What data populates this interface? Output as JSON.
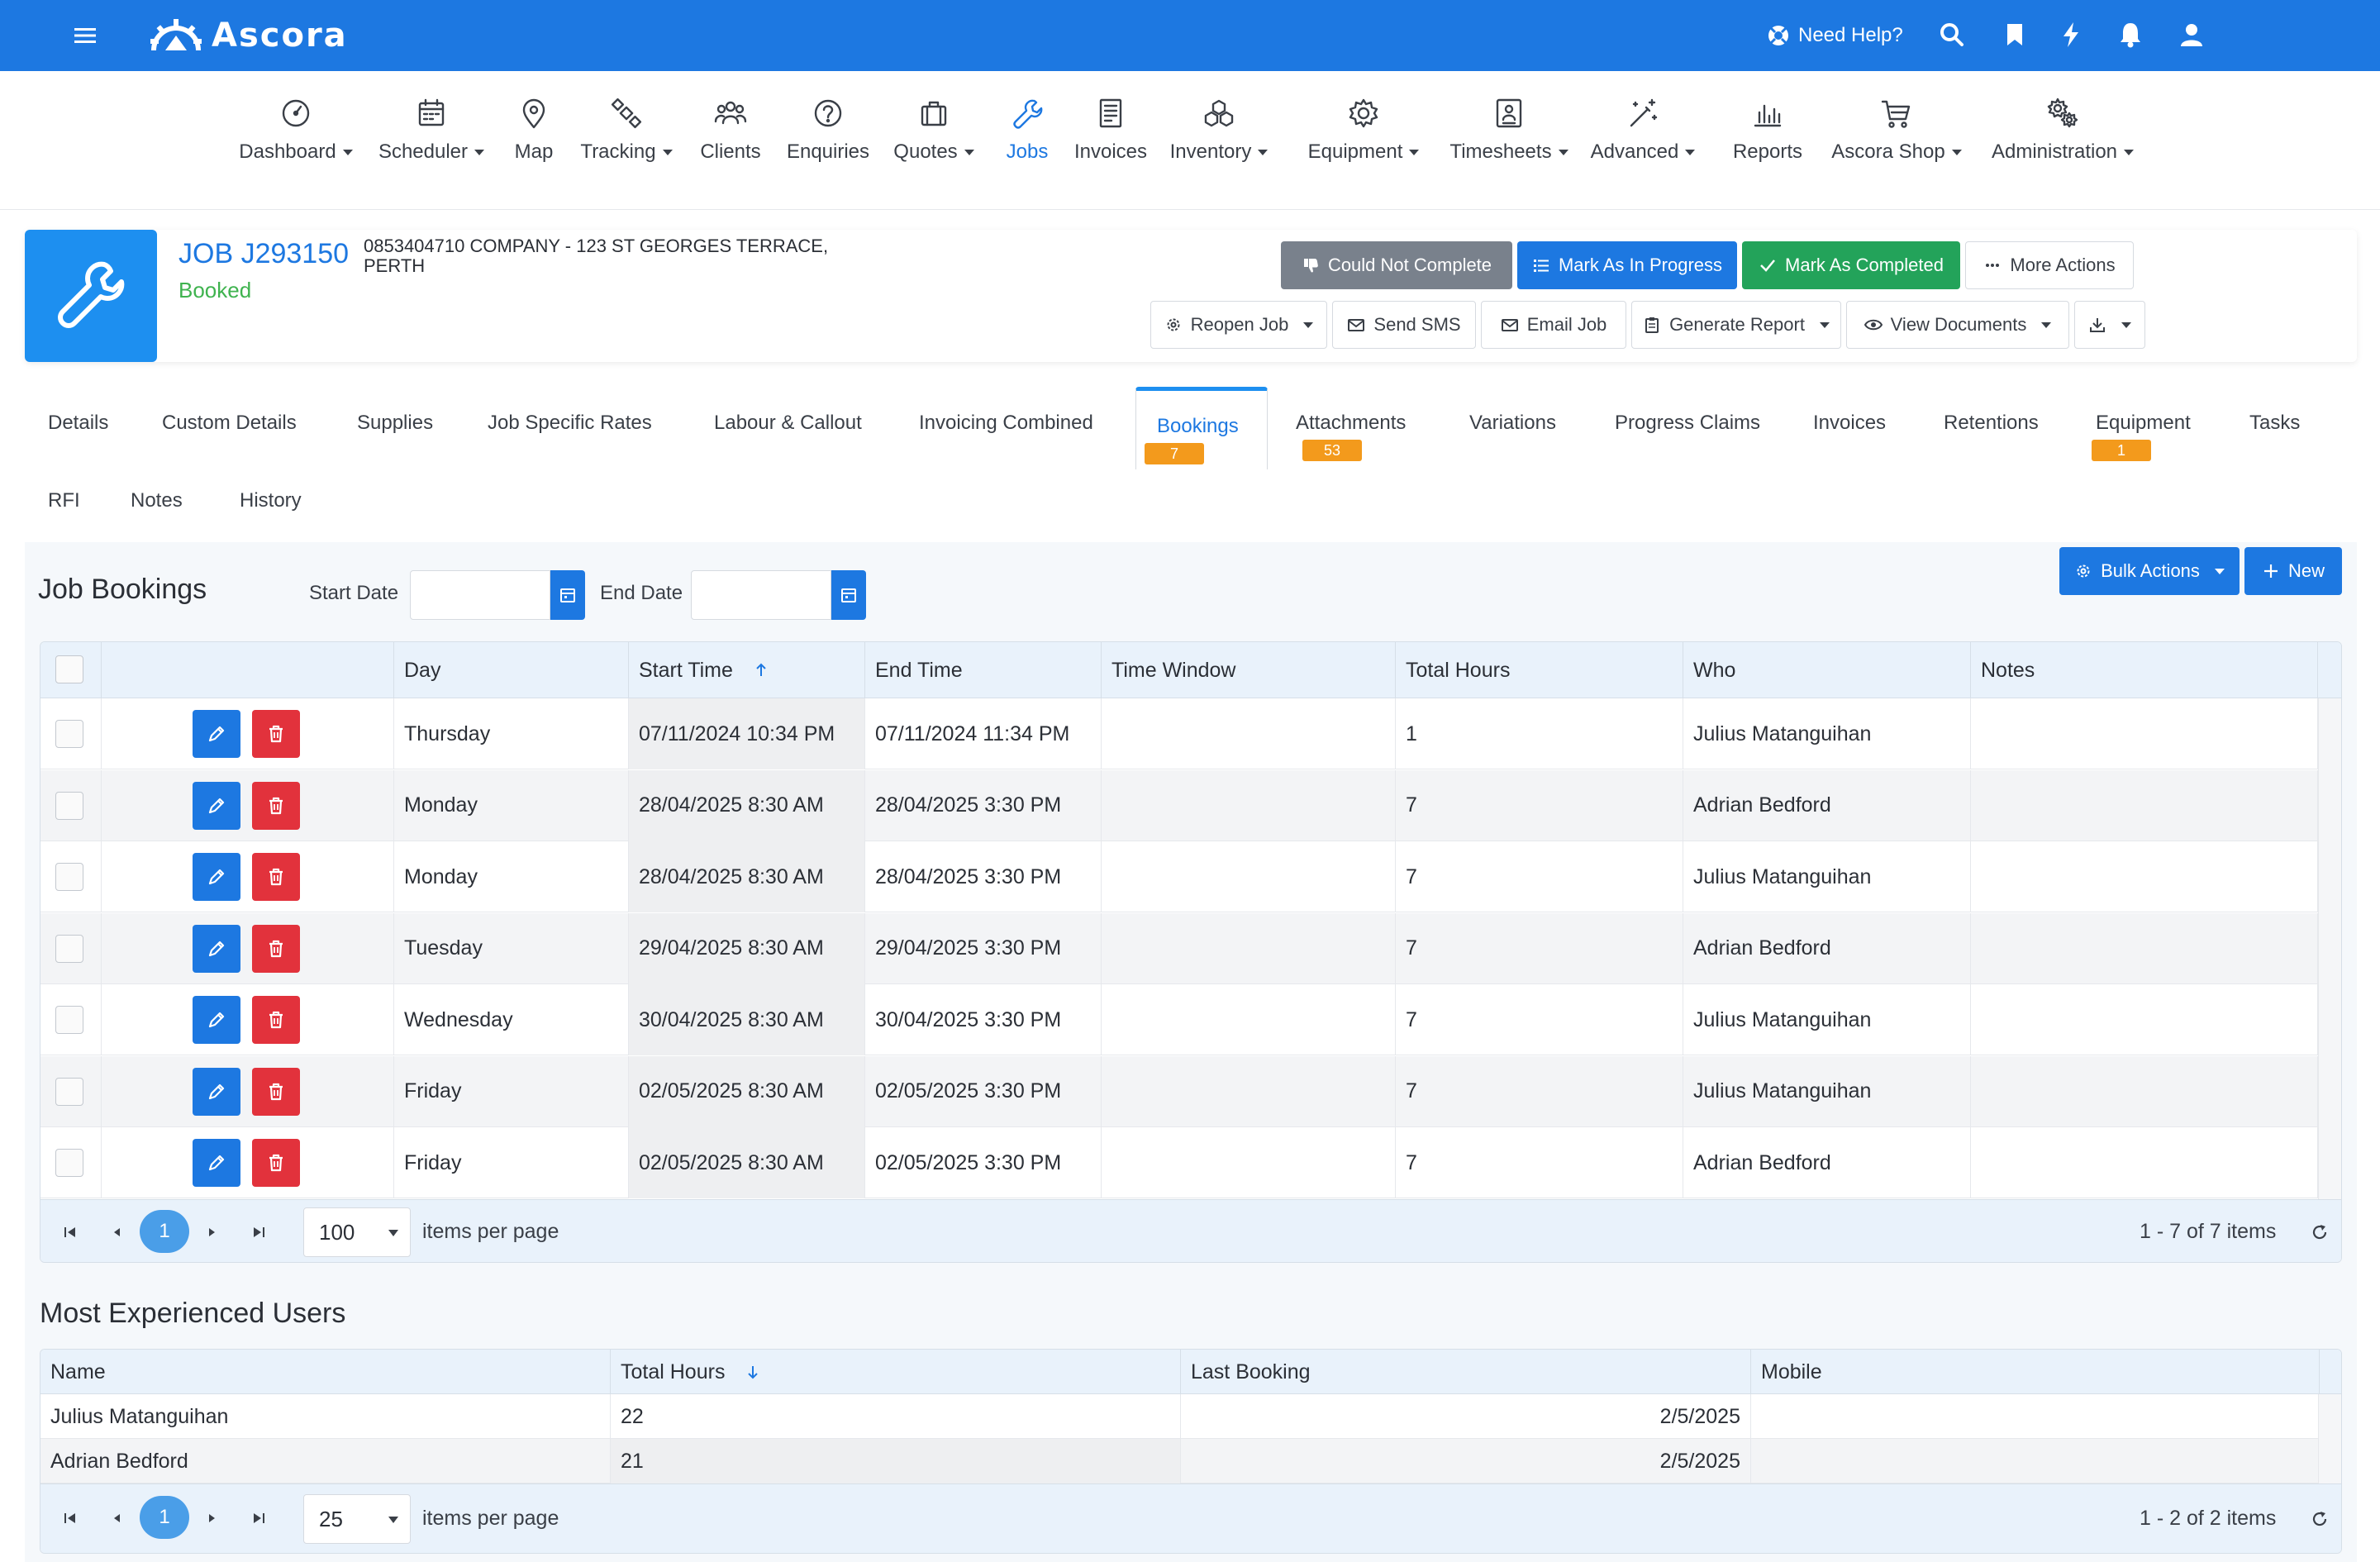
{
  "app": {
    "logo_text": "Ascora",
    "brand_color": "#1d78e1"
  },
  "topbar": {
    "help_label": "Need Help?"
  },
  "nav": [
    {
      "label": "Dashboard",
      "icon": "dashboard-icon",
      "dropdown": true
    },
    {
      "label": "Scheduler",
      "icon": "calendar-icon",
      "dropdown": true
    },
    {
      "label": "Map",
      "icon": "map-pin-icon",
      "dropdown": false
    },
    {
      "label": "Tracking",
      "icon": "satellite-icon",
      "dropdown": true
    },
    {
      "label": "Clients",
      "icon": "users-icon",
      "dropdown": false
    },
    {
      "label": "Enquiries",
      "icon": "question-icon",
      "dropdown": false
    },
    {
      "label": "Quotes",
      "icon": "briefcase-icon",
      "dropdown": true
    },
    {
      "label": "Jobs",
      "icon": "wrench-icon",
      "dropdown": false,
      "active": true
    },
    {
      "label": "Invoices",
      "icon": "invoice-icon",
      "dropdown": false
    },
    {
      "label": "Inventory",
      "icon": "boxes-icon",
      "dropdown": true
    },
    {
      "label": "Equipment",
      "icon": "gear-icon",
      "dropdown": true
    },
    {
      "label": "Timesheets",
      "icon": "timesheet-icon",
      "dropdown": true
    },
    {
      "label": "Advanced",
      "icon": "magic-wand-icon",
      "dropdown": true
    },
    {
      "label": "Reports",
      "icon": "bar-chart-icon",
      "dropdown": false
    },
    {
      "label": "Ascora Shop",
      "icon": "cart-icon",
      "dropdown": true
    },
    {
      "label": "Administration",
      "icon": "gears-icon",
      "dropdown": true
    }
  ],
  "job": {
    "title": "JOB J293150",
    "status": "Booked",
    "address": "0853404710 COMPANY - 123 ST GEORGES TERRACE, PERTH"
  },
  "actions": {
    "could_not_complete": "Could Not Complete",
    "mark_in_progress": "Mark As In Progress",
    "mark_completed": "Mark As Completed",
    "more_actions": "More Actions",
    "reopen_job": "Reopen Job",
    "send_sms": "Send SMS",
    "email_job": "Email Job",
    "generate_report": "Generate Report",
    "view_documents": "View Documents"
  },
  "tabs": [
    {
      "label": "Details"
    },
    {
      "label": "Custom Details"
    },
    {
      "label": "Supplies"
    },
    {
      "label": "Job Specific Rates"
    },
    {
      "label": "Labour & Callout"
    },
    {
      "label": "Invoicing Combined"
    },
    {
      "label": "Bookings",
      "badge": "7",
      "active": true
    },
    {
      "label": "Attachments",
      "badge": "53"
    },
    {
      "label": "Variations"
    },
    {
      "label": "Progress Claims"
    },
    {
      "label": "Invoices"
    },
    {
      "label": "Retentions"
    },
    {
      "label": "Equipment",
      "badge": "1"
    },
    {
      "label": "Tasks"
    },
    {
      "label": "RFI"
    },
    {
      "label": "Notes"
    },
    {
      "label": "History"
    }
  ],
  "bookings": {
    "title": "Job Bookings",
    "start_date_label": "Start Date",
    "end_date_label": "End Date",
    "start_date_value": "",
    "end_date_value": "",
    "bulk_actions_label": "Bulk Actions",
    "new_label": "New",
    "columns": [
      "Day",
      "Start Time",
      "End Time",
      "Time Window",
      "Total Hours",
      "Who",
      "Notes"
    ],
    "rows": [
      {
        "day": "Thursday",
        "start": "07/11/2024 10:34 PM",
        "end": "07/11/2024 11:34 PM",
        "window": "",
        "hours": "1",
        "who": "Julius Matanguihan",
        "notes": ""
      },
      {
        "day": "Monday",
        "start": "28/04/2025 8:30 AM",
        "end": "28/04/2025 3:30 PM",
        "window": "",
        "hours": "7",
        "who": "Adrian Bedford",
        "notes": ""
      },
      {
        "day": "Monday",
        "start": "28/04/2025 8:30 AM",
        "end": "28/04/2025 3:30 PM",
        "window": "",
        "hours": "7",
        "who": "Julius Matanguihan",
        "notes": ""
      },
      {
        "day": "Tuesday",
        "start": "29/04/2025 8:30 AM",
        "end": "29/04/2025 3:30 PM",
        "window": "",
        "hours": "7",
        "who": "Adrian Bedford",
        "notes": ""
      },
      {
        "day": "Wednesday",
        "start": "30/04/2025 8:30 AM",
        "end": "30/04/2025 3:30 PM",
        "window": "",
        "hours": "7",
        "who": "Julius Matanguihan",
        "notes": ""
      },
      {
        "day": "Friday",
        "start": "02/05/2025 8:30 AM",
        "end": "02/05/2025 3:30 PM",
        "window": "",
        "hours": "7",
        "who": "Julius Matanguihan",
        "notes": ""
      },
      {
        "day": "Friday",
        "start": "02/05/2025 8:30 AM",
        "end": "02/05/2025 3:30 PM",
        "window": "",
        "hours": "7",
        "who": "Adrian Bedford",
        "notes": ""
      }
    ],
    "pager": {
      "page": "1",
      "page_size": "100",
      "items_per_page_label": "items per page",
      "summary": "1 - 7 of 7 items"
    }
  },
  "experienced": {
    "title": "Most Experienced Users",
    "columns": [
      "Name",
      "Total Hours",
      "Last Booking",
      "Mobile"
    ],
    "rows": [
      {
        "name": "Julius Matanguihan",
        "hours": "22",
        "last": "2/5/2025",
        "mobile": ""
      },
      {
        "name": "Adrian Bedford",
        "hours": "21",
        "last": "2/5/2025",
        "mobile": ""
      }
    ],
    "pager": {
      "page": "1",
      "page_size": "25",
      "items_per_page_label": "items per page",
      "summary": "1 - 2 of 2 items"
    }
  }
}
